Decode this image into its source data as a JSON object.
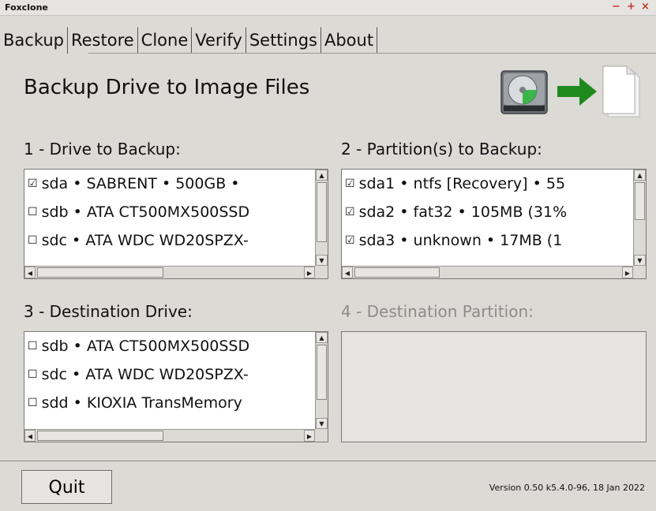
{
  "window": {
    "title": "Foxclone",
    "controls": [
      "−",
      "+",
      "×"
    ]
  },
  "tabs": [
    {
      "label": "Backup"
    },
    {
      "label": "Restore"
    },
    {
      "label": "Clone"
    },
    {
      "label": "Verify"
    },
    {
      "label": "Settings"
    },
    {
      "label": "About"
    }
  ],
  "heading": "Backup Drive to Image Files",
  "icons": {
    "drive": "hard-drive-icon",
    "arrow": "green-arrow-icon",
    "file": "file-icon"
  },
  "section1": {
    "label": "1 - Drive to Backup:",
    "rows": [
      {
        "checkbox": "☑",
        "text": "sda • SABRENT • 500GB •"
      },
      {
        "checkbox": "☐",
        "text": "sdb • ATA CT500MX500SSD"
      },
      {
        "checkbox": "☐",
        "text": "sdc • ATA WDC WD20SPZX-"
      }
    ]
  },
  "section2": {
    "label": "2 - Partition(s) to Backup:",
    "rows": [
      {
        "checkbox": "☑",
        "text": "sda1 • ntfs [Recovery] • 55"
      },
      {
        "checkbox": "☑",
        "text": "sda2 • fat32 • 105MB (31%"
      },
      {
        "checkbox": "☑",
        "text": "sda3 • unknown • 17MB (1"
      }
    ]
  },
  "section3": {
    "label": "3 - Destination Drive:",
    "rows": [
      {
        "checkbox": "☐",
        "text": "sdb • ATA CT500MX500SSD"
      },
      {
        "checkbox": "☐",
        "text": "sdc • ATA WDC WD20SPZX-"
      },
      {
        "checkbox": "☐",
        "text": "sdd • KIOXIA TransMemory"
      }
    ]
  },
  "section4": {
    "label": "4 - Destination Partition:"
  },
  "footer": {
    "quit_label": "Quit",
    "version": "Version 0.50 k5.4.0-96, 18 Jan 2022"
  },
  "colors": {
    "arrow": "#1e8a1e",
    "background": "#dcdad5",
    "disabled_text": "#8e8c88"
  }
}
